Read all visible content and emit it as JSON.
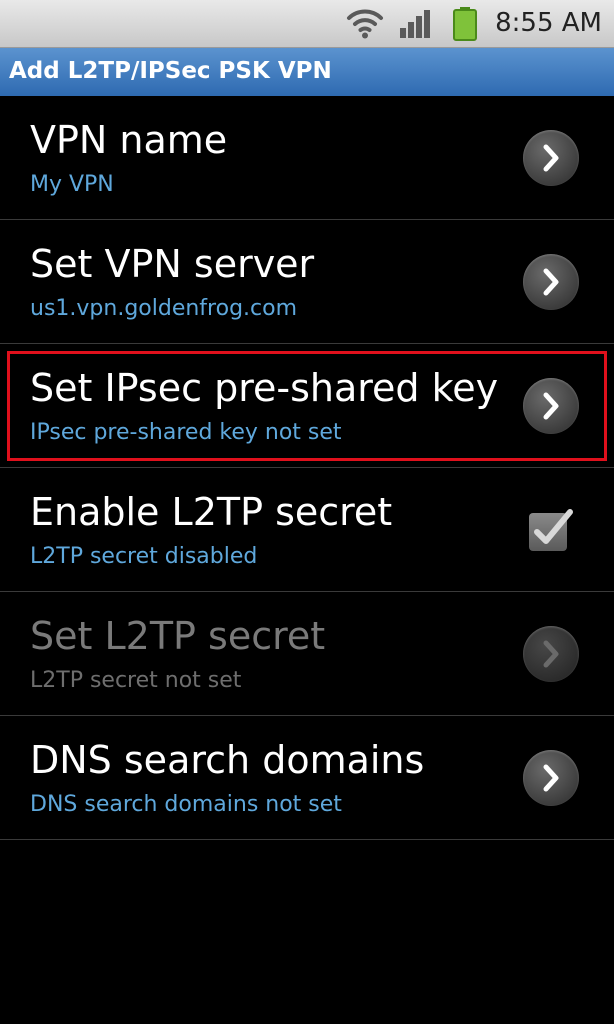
{
  "status_bar": {
    "time": "8:55 AM",
    "icons": [
      "wifi-icon",
      "signal-icon",
      "battery-icon"
    ]
  },
  "title_bar": {
    "title": "Add L2TP/IPSec PSK VPN"
  },
  "colors": {
    "title_bar": "#3a78bf",
    "subtitle": "#5fa8dc",
    "highlight": "#e0101c"
  },
  "items": [
    {
      "title": "VPN name",
      "subtitle": "My VPN",
      "control": "chevron-right-icon",
      "enabled": true
    },
    {
      "title": "Set VPN server",
      "subtitle": "us1.vpn.goldenfrog.com",
      "control": "chevron-right-icon",
      "enabled": true
    },
    {
      "title": "Set IPsec pre-shared key",
      "subtitle": "IPsec pre-shared key not set",
      "control": "chevron-right-icon",
      "enabled": true,
      "highlighted": true
    },
    {
      "title": "Enable L2TP secret",
      "subtitle": "L2TP secret disabled",
      "control": "checkbox",
      "checked": true,
      "enabled": true
    },
    {
      "title": "Set L2TP secret",
      "subtitle": "L2TP secret not set",
      "control": "chevron-right-icon",
      "enabled": false
    },
    {
      "title": "DNS search domains",
      "subtitle": "DNS search domains not set",
      "control": "chevron-right-icon",
      "enabled": true
    }
  ]
}
